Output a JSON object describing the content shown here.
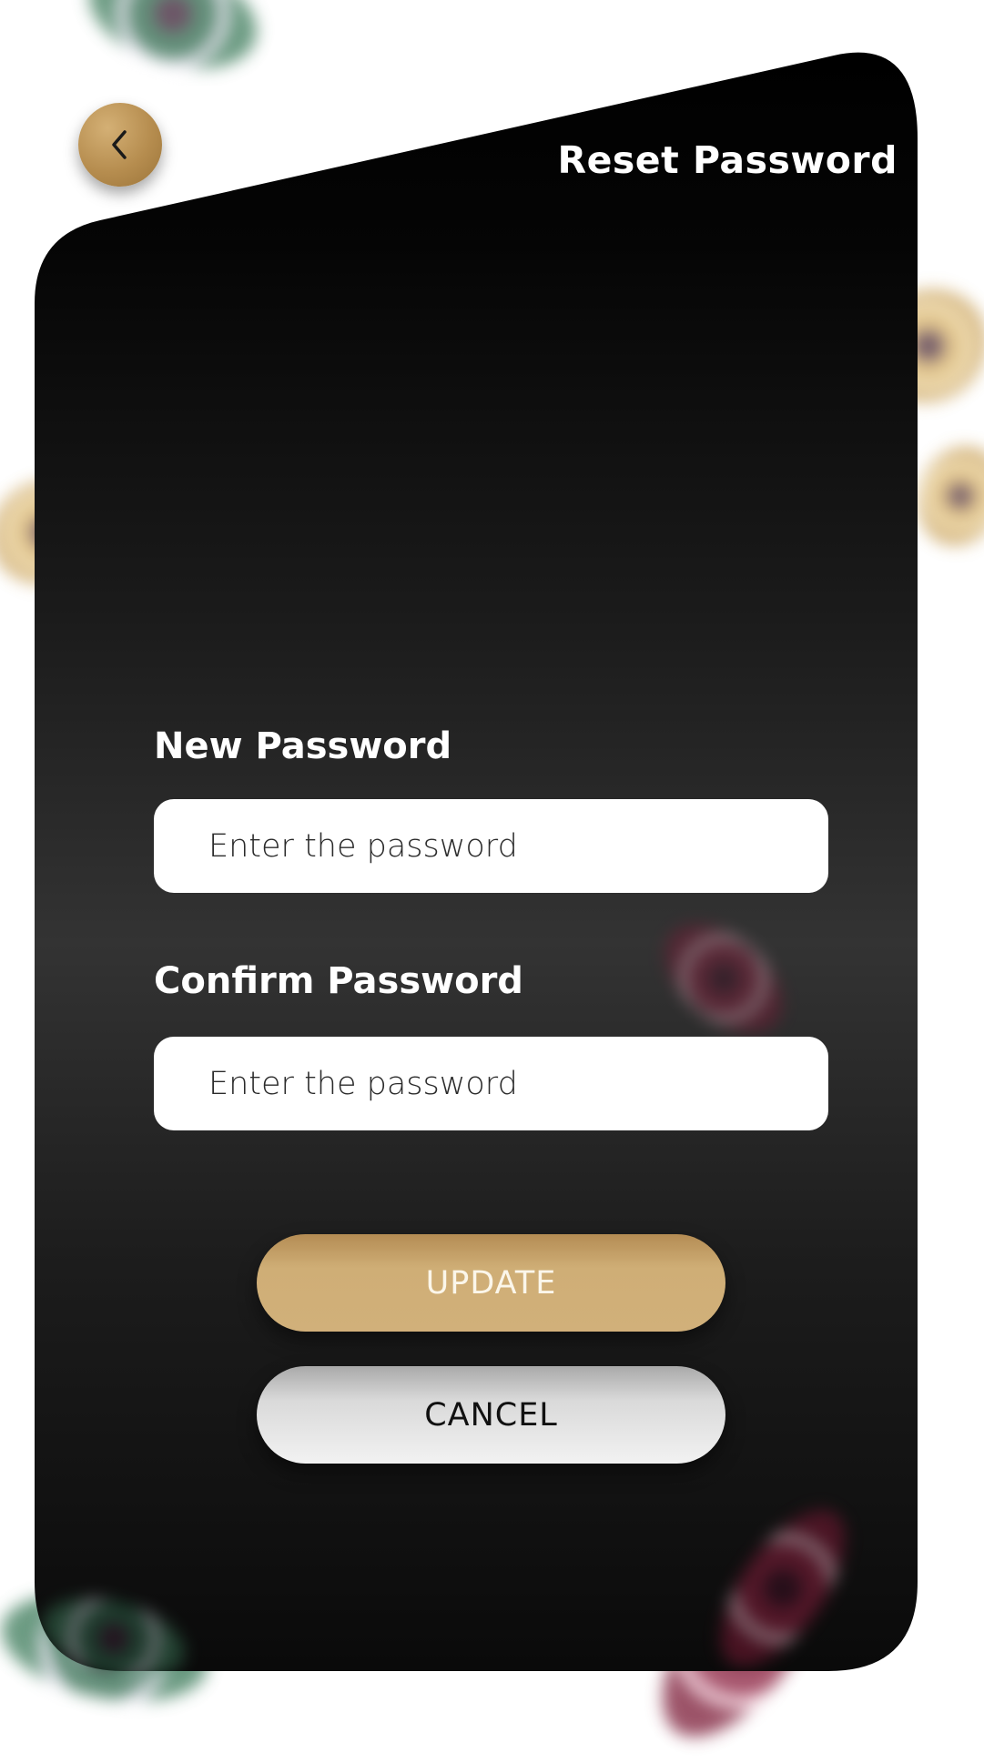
{
  "header": {
    "title": "Reset Password",
    "back_icon": "chevron-left-icon"
  },
  "form": {
    "new_password": {
      "label": "New Password",
      "placeholder": "Enter the password",
      "value": ""
    },
    "confirm_password": {
      "label": "Confirm Password",
      "placeholder": "Enter the password",
      "value": ""
    }
  },
  "actions": {
    "update_label": "UPDATE",
    "cancel_label": "CANCEL"
  },
  "colors": {
    "accent_gold": "#d1b07a",
    "card_dark": "#111111",
    "text_light": "#ffffff"
  }
}
